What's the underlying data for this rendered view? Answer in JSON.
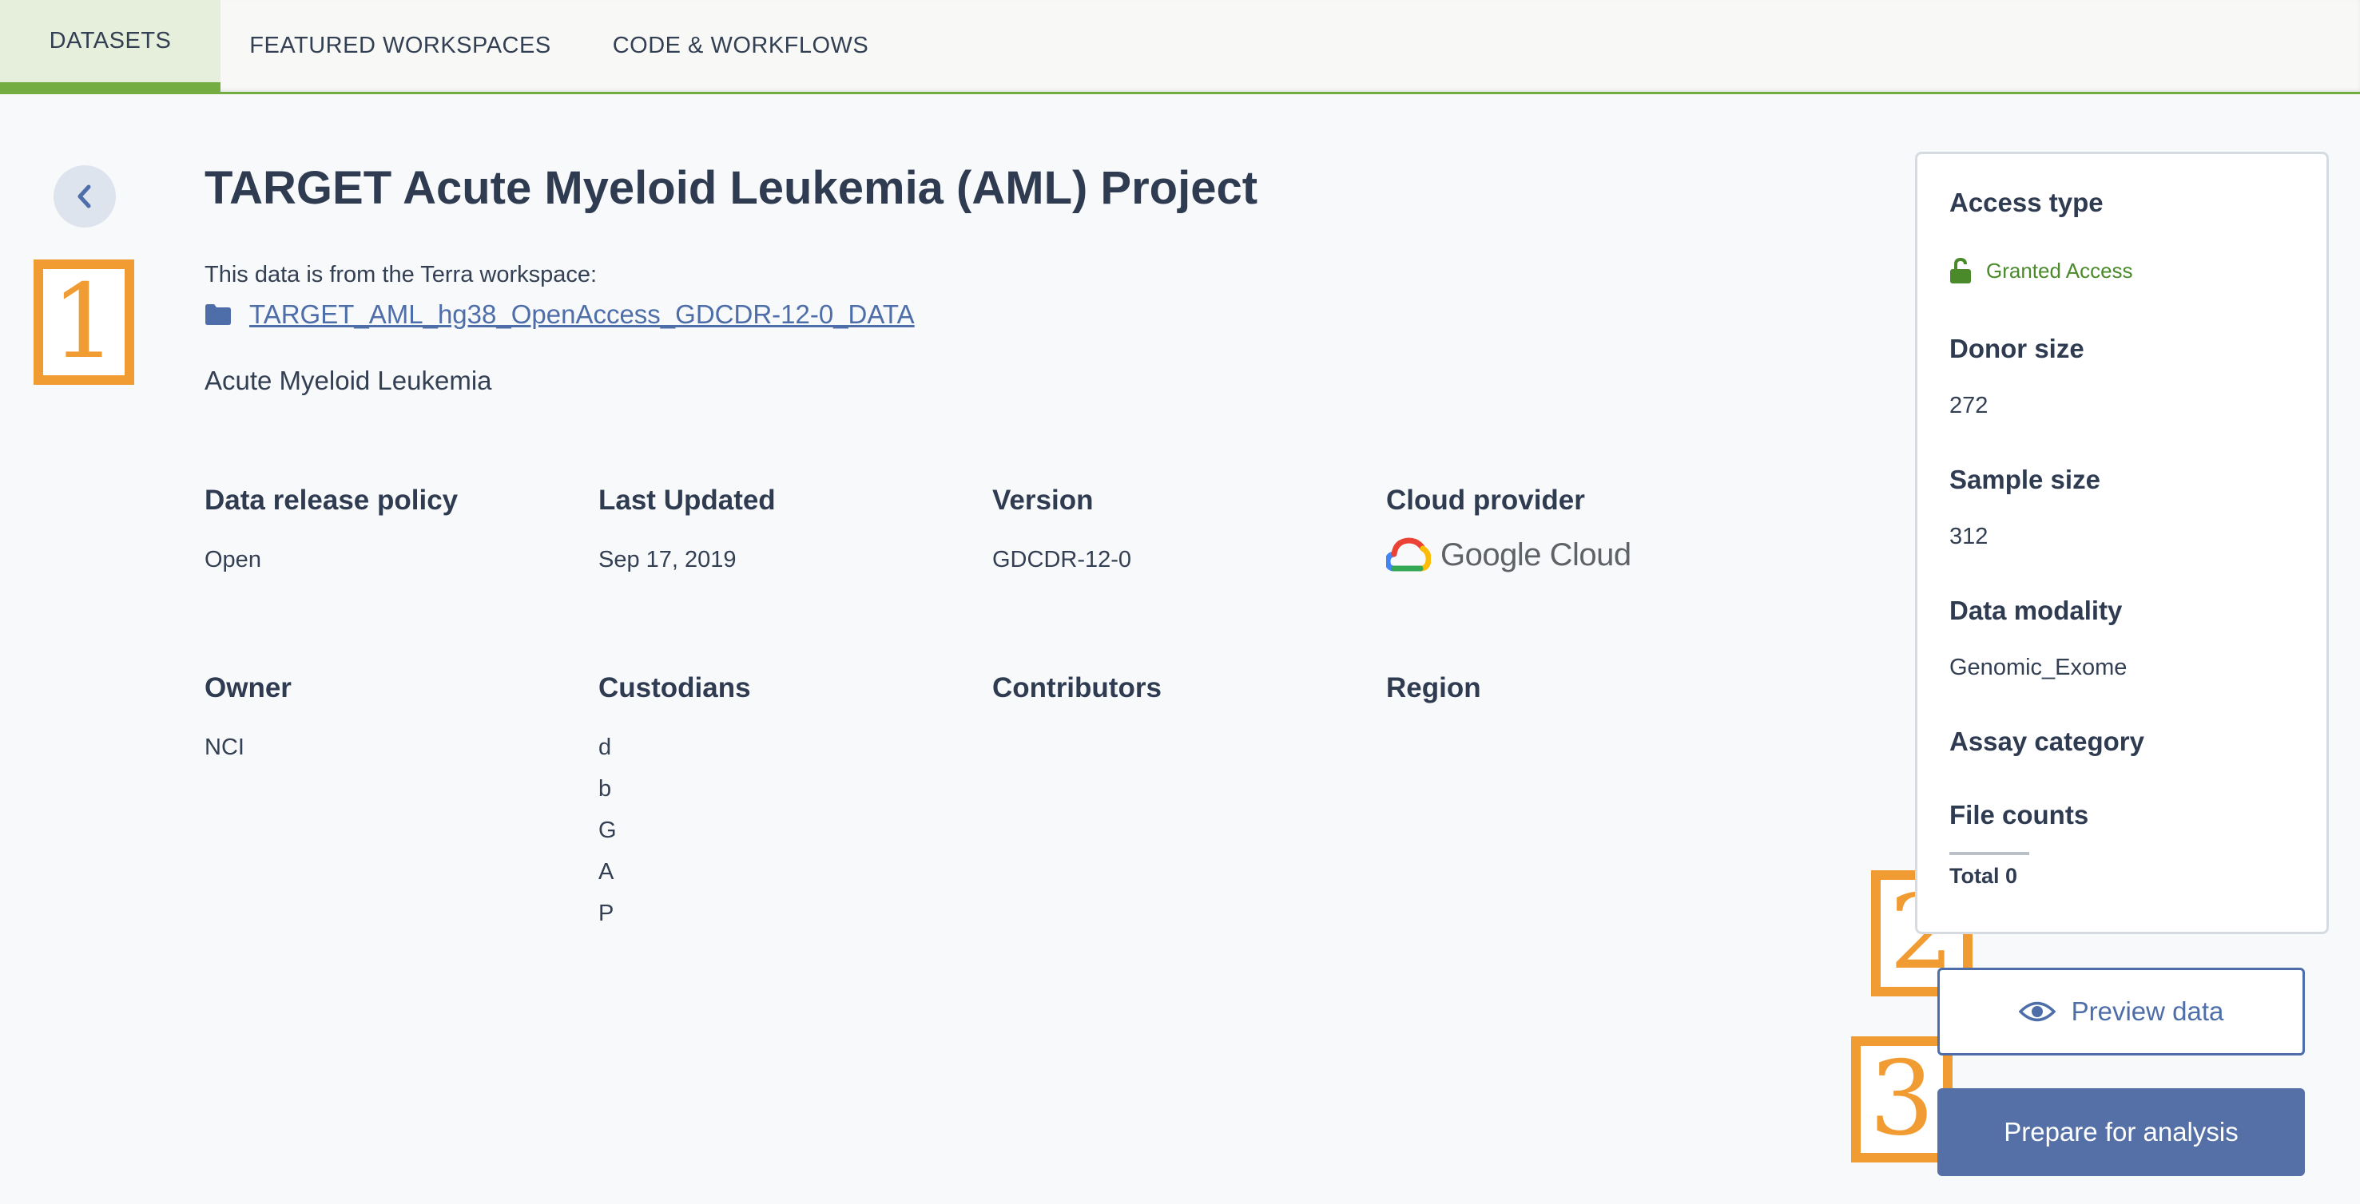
{
  "tabs": [
    {
      "label": "DATASETS",
      "active": true
    },
    {
      "label": "FEATURED WORKSPACES",
      "active": false
    },
    {
      "label": "CODE & WORKFLOWS",
      "active": false
    }
  ],
  "dataset": {
    "title": "TARGET Acute Myeloid Leukemia (AML) Project",
    "source_label": "This data is from the Terra workspace:",
    "workspace_name": "TARGET_AML_hg38_OpenAccess_GDCDR-12-0_DATA",
    "description": "Acute Myeloid Leukemia"
  },
  "details": {
    "release_policy": {
      "label": "Data release policy",
      "value": "Open"
    },
    "last_updated": {
      "label": "Last Updated",
      "value": "Sep 17, 2019"
    },
    "version": {
      "label": "Version",
      "value": "GDCDR-12-0"
    },
    "cloud_provider": {
      "label": "Cloud provider",
      "value": "Google Cloud"
    },
    "owner": {
      "label": "Owner",
      "value": "NCI"
    },
    "custodians": {
      "label": "Custodians",
      "values": [
        "d",
        "b",
        "G",
        "A",
        "P"
      ]
    },
    "contributors": {
      "label": "Contributors"
    },
    "region": {
      "label": "Region"
    }
  },
  "sidebar": {
    "access_type": {
      "label": "Access type",
      "value": "Granted Access"
    },
    "donor_size": {
      "label": "Donor size",
      "value": "272"
    },
    "sample_size": {
      "label": "Sample size",
      "value": "312"
    },
    "data_modality": {
      "label": "Data modality",
      "value": "Genomic_Exome"
    },
    "assay_category": {
      "label": "Assay category"
    },
    "file_counts": {
      "label": "File counts",
      "total": "Total 0"
    }
  },
  "actions": {
    "preview_label": "Preview data",
    "prepare_label": "Prepare for analysis"
  },
  "markers": [
    "1",
    "2",
    "3"
  ],
  "colors": {
    "accent_green": "#74ae43",
    "link_blue": "#4d6ea8",
    "primary_button": "#5570a6",
    "marker_orange": "#f09c33",
    "access_green": "#4a8a2b"
  },
  "icons": {
    "back": "chevron-left-icon",
    "workspace": "folder-icon",
    "access": "unlocked-padlock-icon",
    "preview": "eye-icon",
    "cloud_logo": "google-cloud-logo-icon"
  }
}
